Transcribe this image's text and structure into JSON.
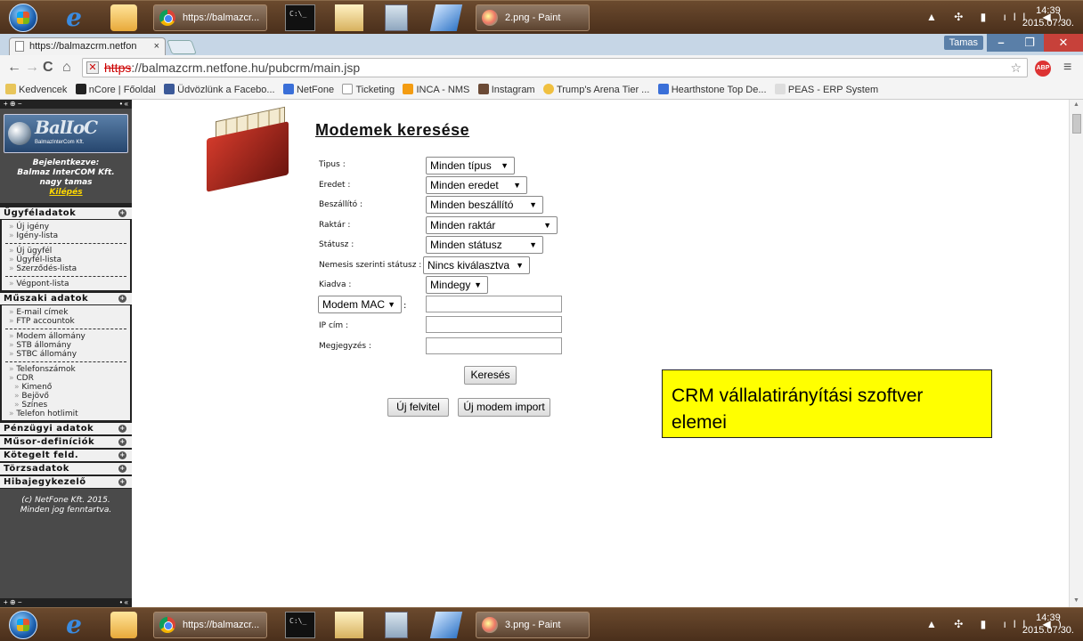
{
  "taskbar_top": {
    "tasks": [
      "https://balmazcr...",
      "2.png - Paint"
    ],
    "clock_time": "14:39",
    "clock_date": "2015.07.30."
  },
  "taskbar_bottom": {
    "tasks": [
      "https://balmazcr...",
      "3.png - Paint"
    ],
    "clock_time": "14:39",
    "clock_date": "2015.07.30."
  },
  "browser": {
    "tab_title": "https://balmazcrm.netfon",
    "user_name": "Tamas",
    "url_protocol": "https",
    "url_rest": "://balmazcrm.netfone.hu/pubcrm/main.jsp",
    "bookmarks": [
      "Kedvencek",
      "nCore | Főoldal",
      "Üdvözlünk a Facebo...",
      "NetFone",
      "Ticketing",
      "INCA - NMS",
      "Instagram",
      "Trump's Arena Tier ...",
      "Hearthstone Top De...",
      "PEAS - ERP System"
    ]
  },
  "sidebar": {
    "login_line1": "Bejelentkezve:",
    "login_line2": "Balmaz InterCOM Kft.",
    "login_line3": "nagy tamas",
    "logout": "Kilépés",
    "logo_text": "BalIoC",
    "logo_sub": "BalmazInterCom Kft.",
    "sections": {
      "ugyfel": "Ügyféladatok",
      "muszaki": "Műszaki adatok",
      "penzugy": "Pénzügyi adatok",
      "musor": "Műsor-definíciók",
      "koteg": "Kötegelt feld.",
      "torzs": "Törzsadatok",
      "hiba": "Hibajegykezelő"
    },
    "ugyfel_items": [
      "Új igény",
      "Igény-lista",
      "Új ügyfél",
      "Ügyfél-lista",
      "Szerződés-lista",
      "Végpont-lista"
    ],
    "muszaki_items": [
      "E-mail címek",
      "FTP accountok",
      "Modem állomány",
      "STB állomány",
      "STBC állomány",
      "Telefonszámok",
      "CDR",
      "Kimenő",
      "Bejövő",
      "Színes",
      "Telefon hotlimit"
    ],
    "copyright1": "(c) NetFone Kft. 2015.",
    "copyright2": "Minden jog fenntartva."
  },
  "form": {
    "title": "Modemek keresése",
    "labels": {
      "tipus": "Tipus :",
      "eredet": "Eredet :",
      "beszallito": "Beszállító :",
      "raktar": "Raktár :",
      "statusz": "Státusz :",
      "nemesis": "Nemesis szerinti státusz :",
      "kiadva": "Kiadva :",
      "ip": "IP cím :",
      "megjegyzes": "Megjegyzés :"
    },
    "selects": {
      "tipus": "Minden típus",
      "eredet": "Minden eredet",
      "beszallito": "Minden beszállító",
      "raktar": "Minden raktár",
      "statusz": "Minden státusz",
      "nemesis": "Nincs kiválasztva",
      "kiadva": "Mindegy",
      "modem_field": "Modem MAC"
    },
    "colon": ":",
    "search_button": "Keresés",
    "new_button": "Új felvitel",
    "import_button": "Új modem import"
  },
  "callout": {
    "line1": "CRM vállalatirányítási szoftver",
    "line2": "elemei"
  }
}
